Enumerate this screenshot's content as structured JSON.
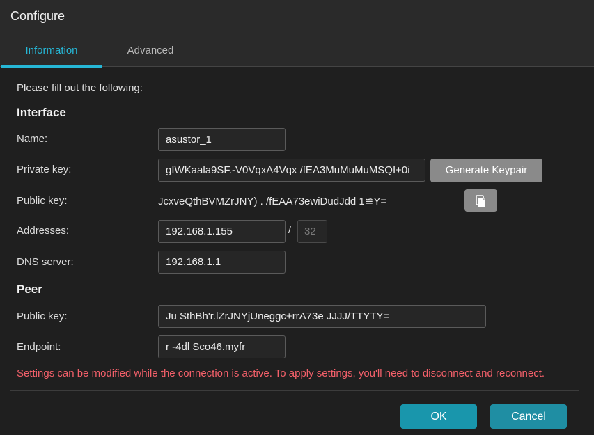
{
  "dialog": {
    "title": "Configure"
  },
  "tabs": [
    {
      "label": "Information",
      "active": true
    },
    {
      "label": "Advanced",
      "active": false
    }
  ],
  "intro": "Please fill out the following:",
  "interface": {
    "heading": "Interface",
    "name_label": "Name:",
    "name_value": "asustor_1",
    "private_key_label": "Private key:",
    "private_key_value": "gIWKaala9SF.-V0VqxA4Vqx /fEA3MuMuMuMSQI+0i",
    "generate_keypair_label": "Generate Keypair",
    "public_key_label": "Public key:",
    "public_key_value": "JcxveQthBVMZrJNY)  .  /fEAA73ewiDudJdd  1≌Y=",
    "copy_icon": "copy-icon",
    "addresses_label": "Addresses:",
    "address_value": "192.168.1.155",
    "address_separator": "/",
    "prefix_value": "32",
    "dns_label": "DNS server:",
    "dns_value": "192.168.1.1"
  },
  "peer": {
    "heading": "Peer",
    "public_key_label": "Public key:",
    "public_key_value": "Ju    SthBh'r.lZrJNYjUneggc+rrA73e      JJJJ/TTYTY=",
    "endpoint_label": "Endpoint:",
    "endpoint_value": "r      -4dl  Sco46.myfr"
  },
  "warning": "Settings can be modified while the connection is active. To apply settings, you'll need to disconnect and reconnect.",
  "buttons": {
    "ok": "OK",
    "cancel": "Cancel"
  },
  "colors": {
    "accent": "#26b7d6",
    "warning": "#f4606a",
    "primary_button": "#1996ac",
    "secondary_button": "#8a8a8a"
  }
}
